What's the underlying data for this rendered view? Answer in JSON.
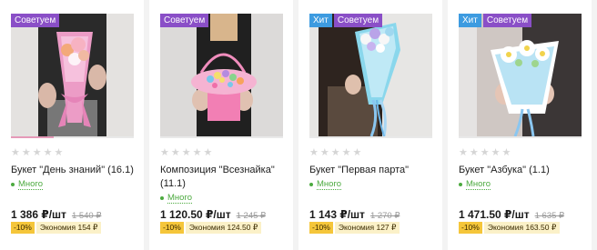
{
  "products": [
    {
      "badges": [
        {
          "type": "advice",
          "label": "Советуем"
        }
      ],
      "title": "Букет \"День знаний\" (16.1)",
      "stock": "Много",
      "price": "1 386 ₽/шт",
      "old_price": "1 540 ₽",
      "discount": "-10%",
      "saving": "Экономия 154 ₽",
      "rating": 0,
      "rating_max": 5,
      "gallery_progress": 0.35
    },
    {
      "badges": [
        {
          "type": "advice",
          "label": "Советуем"
        }
      ],
      "title": "Композиция \"Всезнайка\" (11.1)",
      "stock": "Много",
      "price": "1 120.50 ₽/шт",
      "old_price": "1 245 ₽",
      "discount": "-10%",
      "saving": "Экономия 124.50 ₽",
      "rating": 0,
      "rating_max": 5,
      "gallery_progress": 0
    },
    {
      "badges": [
        {
          "type": "hit",
          "label": "Хит"
        },
        {
          "type": "advice",
          "label": "Советуем"
        }
      ],
      "title": "Букет \"Первая парта\"",
      "stock": "Много",
      "price": "1 143 ₽/шт",
      "old_price": "1 270 ₽",
      "discount": "-10%",
      "saving": "Экономия 127 ₽",
      "rating": 0,
      "rating_max": 5,
      "gallery_progress": 0
    },
    {
      "badges": [
        {
          "type": "hit",
          "label": "Хит"
        },
        {
          "type": "advice",
          "label": "Советуем"
        }
      ],
      "title": "Букет \"Азбука\" (1.1)",
      "stock": "Много",
      "price": "1 471.50 ₽/шт",
      "old_price": "1 635 ₽",
      "discount": "-10%",
      "saving": "Экономия 163.50 ₽",
      "rating": 0,
      "rating_max": 5,
      "gallery_progress": 0
    }
  ],
  "colors": {
    "advice_badge": "#8a4fc7",
    "hit_badge": "#3d9be0",
    "in_stock": "#4caa3f",
    "discount": "#f5c63a",
    "saving": "#fbf1c8"
  },
  "icons": {
    "rating": "star-icon",
    "stock": "dot-icon"
  }
}
